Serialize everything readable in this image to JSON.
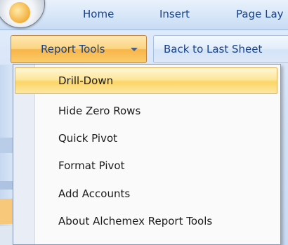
{
  "ribbon": {
    "tabs": [
      "Home",
      "Insert",
      "Page Lay"
    ]
  },
  "toolbar": {
    "report_tools_label": "Report Tools",
    "back_label": "Back to Last Sheet"
  },
  "menu": {
    "items": [
      {
        "label": "Drill-Down",
        "state": "highlighted"
      },
      {
        "label": "Hide Zero Rows"
      },
      {
        "label": "Quick Pivot"
      },
      {
        "label": "Format Pivot"
      },
      {
        "label": "Add Accounts"
      },
      {
        "label": "About Alchemex Report Tools"
      }
    ]
  },
  "colors": {
    "ribbon_text": "#15428b",
    "highlight": "#fbd567",
    "button_active": "#f8b548"
  }
}
